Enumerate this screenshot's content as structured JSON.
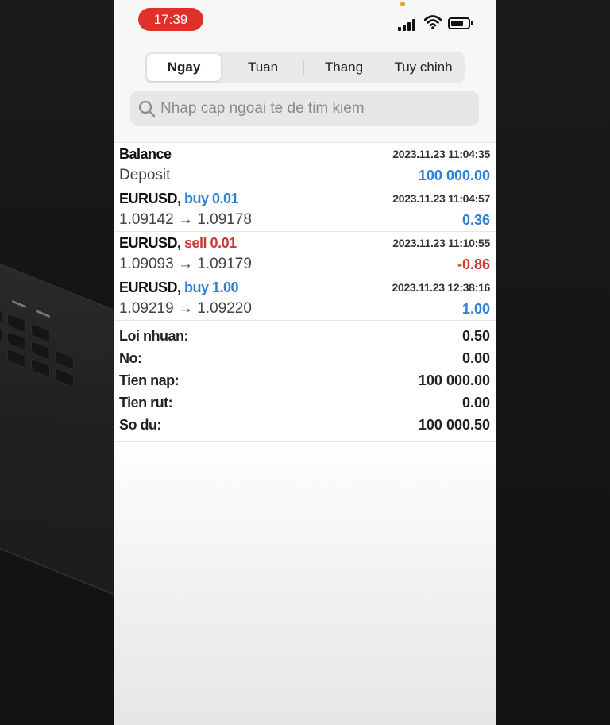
{
  "status_bar": {
    "time": "17:39"
  },
  "tabs": [
    {
      "label": "Ngay",
      "active": true
    },
    {
      "label": "Tuan",
      "active": false
    },
    {
      "label": "Thang",
      "active": false
    },
    {
      "label": "Tuy chinh",
      "active": false
    }
  ],
  "search": {
    "placeholder": "Nhap cap ngoai te de tim kiem"
  },
  "deals": [
    {
      "title": "Balance",
      "action": "",
      "subtitle": "Deposit",
      "datetime": "2023.11.23 11:04:35",
      "amount": "100 000.00",
      "action_color": "#2f7fd6",
      "amount_color": "#2f7fd6"
    },
    {
      "title": "EURUSD,",
      "action": "buy 0.01",
      "subtitle": "1.09142 → 1.09178",
      "datetime": "2023.11.23 11:04:57",
      "amount": "0.36",
      "action_color": "#2f7fd6",
      "amount_color": "#2f7fd6"
    },
    {
      "title": "EURUSD,",
      "action": "sell 0.01",
      "subtitle": "1.09093 → 1.09179",
      "datetime": "2023.11.23 11:10:55",
      "amount": "-0.86",
      "action_color": "#cc3a33",
      "amount_color": "#cc3a33"
    },
    {
      "title": "EURUSD,",
      "action": "buy 1.00",
      "subtitle": "1.09219 → 1.09220",
      "datetime": "2023.11.23 12:38:16",
      "amount": "1.00",
      "action_color": "#2f7fd6",
      "amount_color": "#2f7fd6"
    }
  ],
  "summary": [
    {
      "label": "Loi nhuan:",
      "value": "0.50"
    },
    {
      "label": "No:",
      "value": "0.00"
    },
    {
      "label": "Tien nap:",
      "value": "100 000.00"
    },
    {
      "label": "Tien rut:",
      "value": "0.00"
    },
    {
      "label": "So du:",
      "value": "100 000.50"
    }
  ],
  "colors": {
    "buy": "#2f7fd6",
    "sell": "#cc3a33",
    "time_pill": "#e0302b"
  }
}
